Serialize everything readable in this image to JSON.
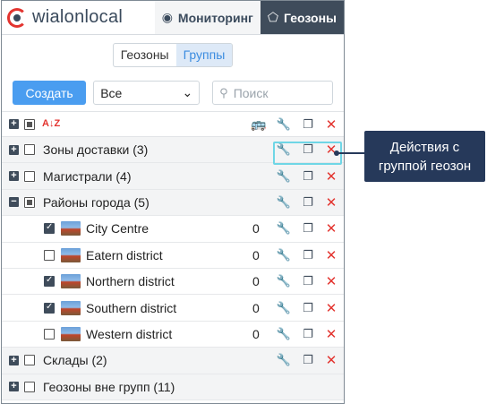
{
  "app": {
    "logo_text": "wialonlocal",
    "tabs": [
      {
        "label": "Мониторинг",
        "icon": "monitoring-globe-icon",
        "active": false
      },
      {
        "label": "Геозоны",
        "icon": "geofence-icon",
        "active": true
      }
    ]
  },
  "view_toggle": {
    "geofences": "Геозоны",
    "groups": "Группы",
    "selected": "Группы"
  },
  "controls": {
    "create_label": "Создать",
    "filter_value": "Все",
    "search_placeholder": "Поиск"
  },
  "tools_header": {
    "sort_label": "A↓Z"
  },
  "groups": [
    {
      "label": "Зоны доставки (3)",
      "expanded": false,
      "checkbox": "unchecked"
    },
    {
      "label": "Магистрали (4)",
      "expanded": false,
      "checkbox": "unchecked"
    },
    {
      "label": "Районы города (5)",
      "expanded": true,
      "checkbox": "partial",
      "items": [
        {
          "label": "City Centre",
          "count": "0",
          "checked": true
        },
        {
          "label": "Eatern district",
          "count": "0",
          "checked": false
        },
        {
          "label": "Northern district",
          "count": "0",
          "checked": true
        },
        {
          "label": "Southern district",
          "count": "0",
          "checked": true
        },
        {
          "label": "Western district",
          "count": "0",
          "checked": false
        }
      ]
    },
    {
      "label": "Склады (2)",
      "expanded": false,
      "checkbox": "unchecked"
    },
    {
      "label": "Геозоны вне групп (11)",
      "expanded": false,
      "checkbox": "unchecked"
    }
  ],
  "callout": {
    "line1": "Действия с",
    "line2": "группой геозон"
  },
  "colors": {
    "accent": "#4a9df0",
    "dark": "#3f4c5b",
    "delete": "#e3342f",
    "callout_bg": "#26395a",
    "highlight": "#6fd6e6"
  }
}
